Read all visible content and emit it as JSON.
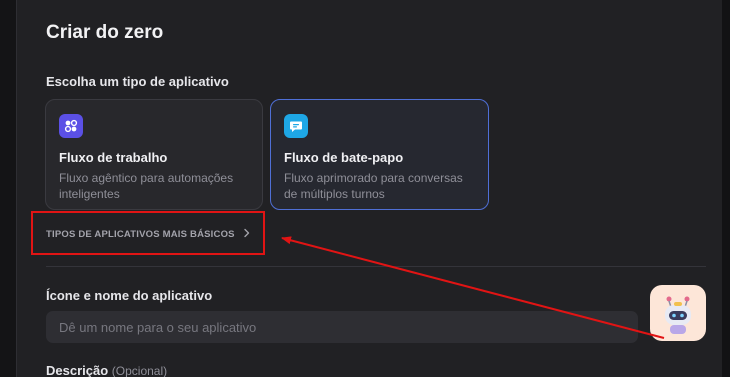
{
  "page": {
    "title": "Criar do zero",
    "app_type_label": "Escolha um tipo de aplicativo"
  },
  "cards": [
    {
      "title": "Fluxo de trabalho",
      "description": "Fluxo agêntico para automações inteligentes",
      "icon": "workflow-icon",
      "icon_color": "#5b50e6",
      "selected": false
    },
    {
      "title": "Fluxo de bate-papo",
      "description": "Fluxo aprimorado para conversas de múltiplos turnos",
      "icon": "chat-bubble-icon",
      "icon_color": "#1ea7e6",
      "selected": true
    }
  ],
  "more_types": {
    "label": "TIPOS DE APLICATIVOS MAIS BÁSICOS",
    "icon": "chevron-right-icon"
  },
  "name_field": {
    "label": "Ícone e nome do aplicativo",
    "placeholder": "Dê um nome para o seu aplicativo",
    "value": ""
  },
  "description_field": {
    "label": "Descrição",
    "optional": "(Opcional)"
  },
  "colors": {
    "annotation": "#e11414",
    "selected_border": "#4f6fd6",
    "panel": "#212124"
  }
}
